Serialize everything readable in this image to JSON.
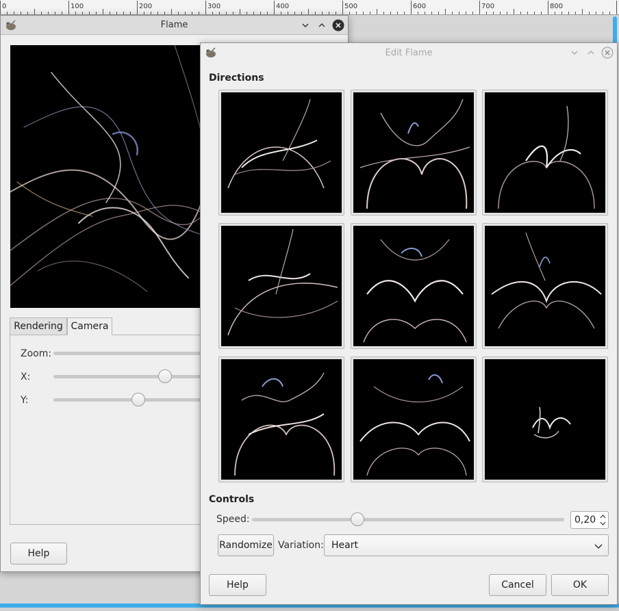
{
  "ruler": {
    "labels": [
      "0",
      "100",
      "200",
      "300",
      "400",
      "500",
      "600",
      "700",
      "800"
    ]
  },
  "flame_window": {
    "title": "Flame",
    "tabs": [
      {
        "label": "Rendering"
      },
      {
        "label": "Camera"
      }
    ],
    "camera": {
      "zoom_label": "Zoom:",
      "x_label": "X:",
      "y_label": "Y:"
    },
    "help_label": "Help"
  },
  "edit_window": {
    "title": "Edit Flame",
    "directions_heading": "Directions",
    "controls_heading": "Controls",
    "speed_label": "Speed:",
    "speed_value": "0,20",
    "randomize_label": "Randomize",
    "variation_label": "Variation:",
    "variation_value": "Heart",
    "help_label": "Help",
    "cancel_label": "Cancel",
    "ok_label": "OK"
  },
  "colors": {
    "accent": "#3daee9",
    "preview_bg": "#000000"
  }
}
